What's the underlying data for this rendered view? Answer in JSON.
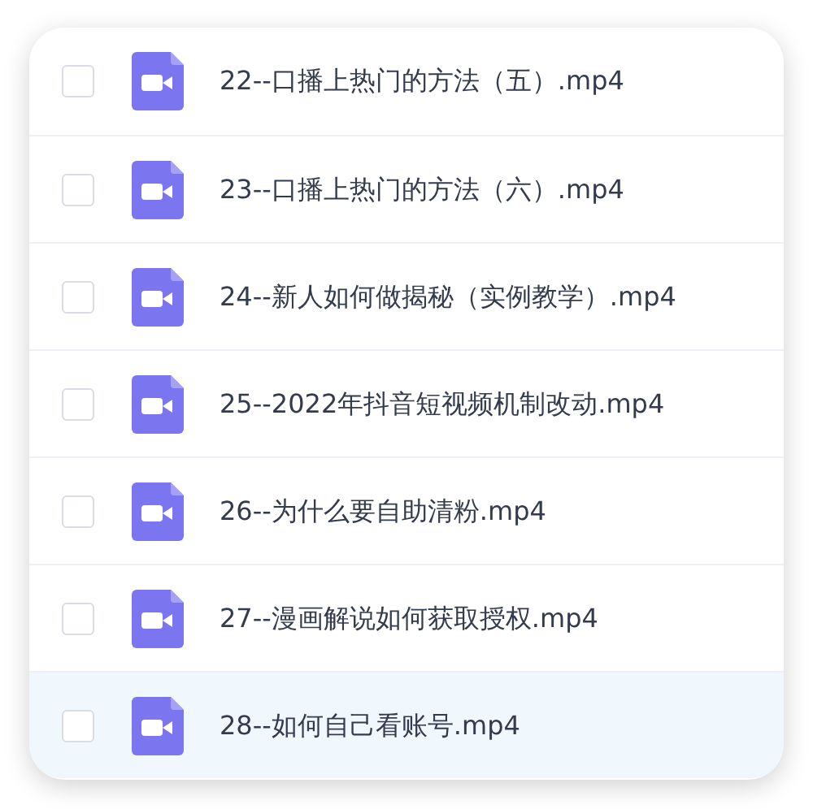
{
  "files": [
    {
      "name": "22--口播上热门的方法（五）.mp4",
      "checked": false,
      "selected": false
    },
    {
      "name": "23--口播上热门的方法（六）.mp4",
      "checked": false,
      "selected": false
    },
    {
      "name": "24--新人如何做揭秘（实例教学）.mp4",
      "checked": false,
      "selected": false
    },
    {
      "name": "25--2022年抖音短视频机制改动.mp4",
      "checked": false,
      "selected": false
    },
    {
      "name": "26--为什么要自助清粉.mp4",
      "checked": false,
      "selected": false
    },
    {
      "name": "27--漫画解说如何获取授权.mp4",
      "checked": false,
      "selected": false
    },
    {
      "name": "28--如何自己看账号.mp4",
      "checked": false,
      "selected": true
    }
  ]
}
